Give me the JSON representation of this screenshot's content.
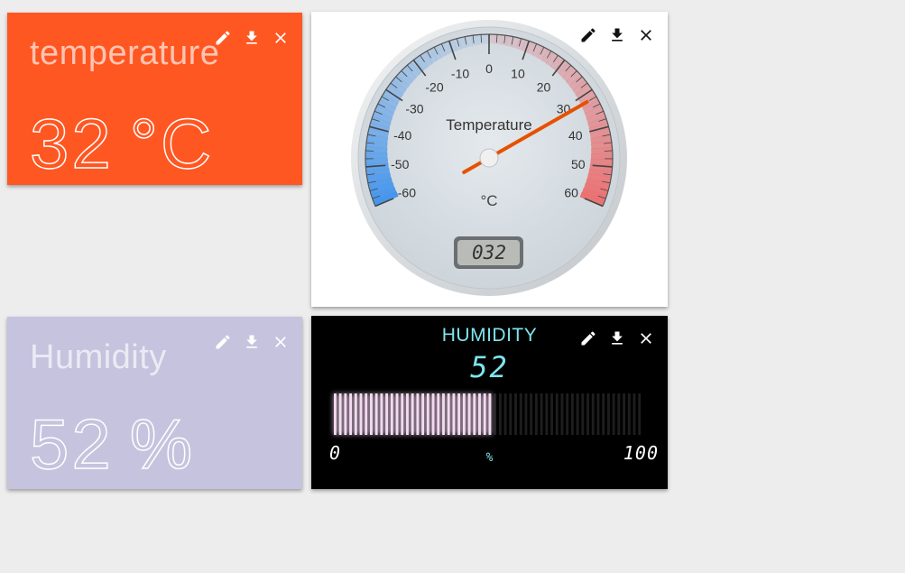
{
  "cards": {
    "temperature_text": {
      "title": "temperature",
      "value": "32",
      "unit": "°C",
      "bg": "#ff5722"
    },
    "humidity_text": {
      "title": "Humidity",
      "value": "52",
      "unit": "%",
      "bg": "#c5c3de"
    },
    "temperature_gauge": {
      "label": "Temperature",
      "unit": "°C",
      "value": 32,
      "display": "032",
      "min": -60,
      "max": 60,
      "ticks": [
        "-60",
        "-50",
        "-40",
        "-30",
        "-20",
        "-10",
        "0",
        "10",
        "20",
        "30",
        "40",
        "50",
        "60"
      ]
    },
    "humidity_lcd": {
      "title": "HUMIDITY",
      "value": "52",
      "level": 52,
      "min": "0",
      "max": "100",
      "unit": "%",
      "color": "#7fe4ee"
    }
  },
  "tools": {
    "edit_icon": "pencil-icon",
    "download_icon": "download-icon",
    "close_icon": "close-icon"
  }
}
